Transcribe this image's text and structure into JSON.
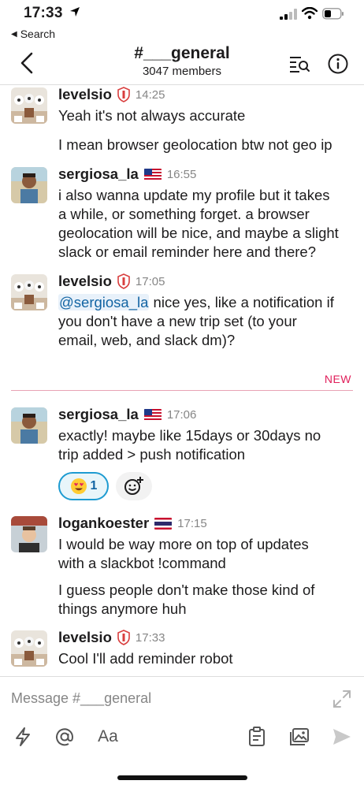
{
  "status": {
    "time": "17:33",
    "back_app": "Search"
  },
  "header": {
    "channel": "#___general",
    "members": "3047 members"
  },
  "messages": [
    {
      "author": "levelsio",
      "time": "14:25",
      "lines": [
        "Yeah it's not always accurate"
      ],
      "lines2": [
        "I mean browser geolocation btw not geo ip"
      ]
    },
    {
      "author": "sergiosa_la",
      "time": "16:55",
      "lines": [
        "i also wanna update my profile but it takes",
        "a while, or something forget. a browser",
        "geolocation will be nice, and maybe a slight",
        "slack or email reminder here and there?"
      ]
    },
    {
      "author": "levelsio",
      "time": "17:05",
      "mention": "@sergiosa_la",
      "first_line_rest": " nice yes, like a notification if",
      "lines": [
        "you don't have a new trip set (to your",
        "email, web, and slack dm)?"
      ]
    },
    {
      "author": "sergiosa_la",
      "time": "17:06",
      "lines": [
        "exactly! maybe like 15days or 30days no",
        "trip added > push notification"
      ],
      "reaction_count": "1"
    },
    {
      "author": "logankoester",
      "time": "17:15",
      "lines": [
        "I would be way more on top of updates",
        "with a slackbot !command"
      ],
      "lines2": [
        "I guess people don't make those kind of",
        "things anymore huh"
      ]
    },
    {
      "author": "levelsio",
      "time": "17:33",
      "lines": [
        "Cool I'll add reminder robot"
      ]
    }
  ],
  "divider": {
    "label": "NEW"
  },
  "composer": {
    "placeholder": "Message #___general",
    "format_label": "Aa"
  },
  "colors": {
    "mention": "#1264a3",
    "new": "#e01e5a",
    "reaction_border": "#1d9bd1"
  },
  "icons": [
    "location-arrow-icon",
    "signal-icon",
    "wifi-icon",
    "battery-icon",
    "back-chevron-icon",
    "search-in-channel-icon",
    "info-icon",
    "shield-badge-icon",
    "us-flag-icon",
    "thai-flag-icon",
    "heart-eyes-emoji-icon",
    "add-reaction-icon",
    "expand-icon",
    "shortcuts-lightning-icon",
    "mention-at-icon",
    "clipboard-icon",
    "photo-icon",
    "send-icon"
  ]
}
